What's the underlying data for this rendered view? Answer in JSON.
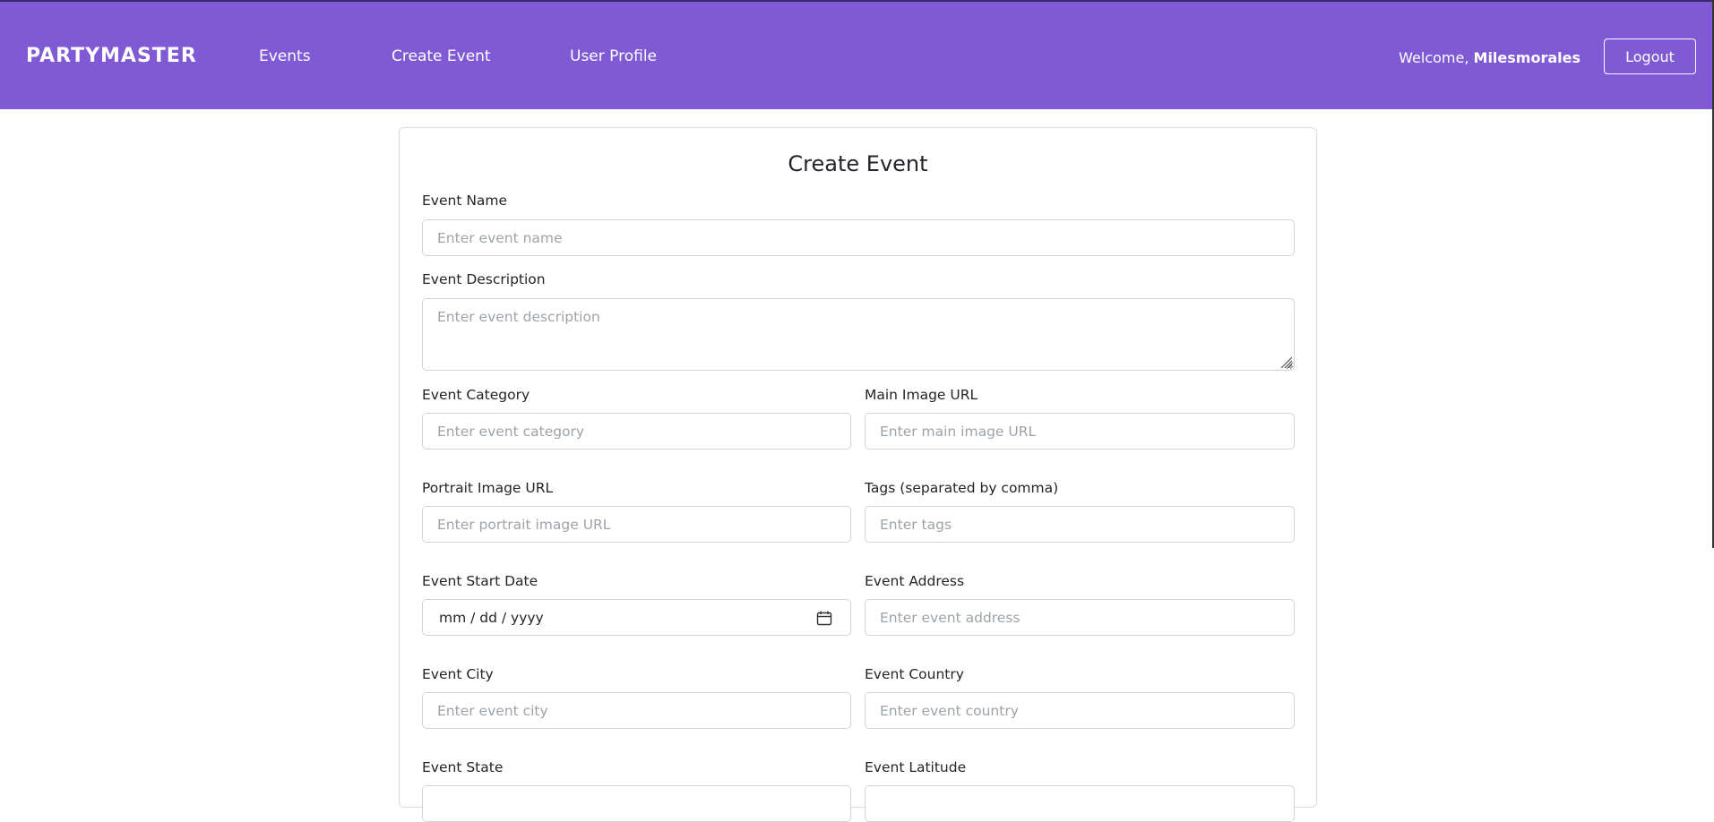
{
  "navbar": {
    "brand": "PARTYMASTER",
    "links": [
      "Events",
      "Create Event",
      "User Profile"
    ],
    "welcome_prefix": "Welcome, ",
    "username": "Milesmorales",
    "logout_label": "Logout",
    "background": "#805AD5"
  },
  "form": {
    "title": "Create Event",
    "event_name": {
      "label": "Event Name",
      "placeholder": "Enter event name"
    },
    "event_description": {
      "label": "Event Description",
      "placeholder": "Enter event description"
    },
    "event_category": {
      "label": "Event Category",
      "placeholder": "Enter event category"
    },
    "main_image_url": {
      "label": "Main Image URL",
      "placeholder": "Enter main image URL"
    },
    "portrait_image_url": {
      "label": "Portrait Image URL",
      "placeholder": "Enter portrait image URL"
    },
    "tags": {
      "label": "Tags (separated by comma)",
      "placeholder": "Enter tags"
    },
    "event_start_date": {
      "label": "Event Start Date",
      "value": "mm / dd / yyyy"
    },
    "event_address": {
      "label": "Event Address",
      "placeholder": "Enter event address"
    },
    "event_city": {
      "label": "Event City",
      "placeholder": "Enter event city"
    },
    "event_country": {
      "label": "Event Country",
      "placeholder": "Enter event country"
    },
    "event_state": {
      "label": "Event State"
    },
    "event_latitude": {
      "label": "Event Latitude"
    }
  },
  "icons": {
    "calendar": "calendar-icon",
    "resize": "resize-grip-icon"
  }
}
